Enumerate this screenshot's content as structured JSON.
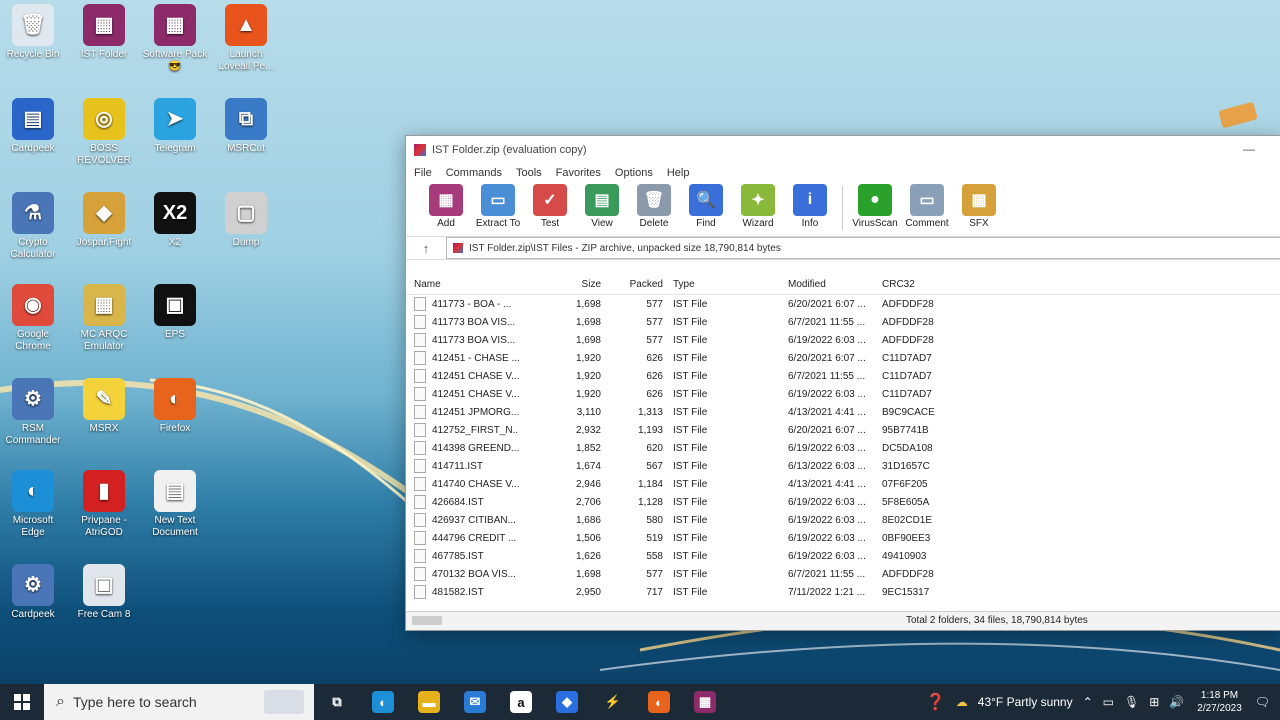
{
  "desktop": {
    "icons": [
      {
        "label": "Recycle Bin",
        "glyph": "🗑",
        "color": "#dfe8ef"
      },
      {
        "label": "IST Folder",
        "glyph": "▦",
        "color": "#8c2a6a"
      },
      {
        "label": "Software Pack 😎",
        "glyph": "▦",
        "color": "#8c2a6a"
      },
      {
        "label": "Launch Loveall Pe...",
        "glyph": "▲",
        "color": "#e8541c"
      },
      {
        "label": "Cardpeek",
        "glyph": "▤",
        "color": "#2a66c9"
      },
      {
        "label": "BOSS REVOLVER",
        "glyph": "◎",
        "color": "#e8c21c"
      },
      {
        "label": "Telegram",
        "glyph": "➤",
        "color": "#2aa3df"
      },
      {
        "label": "MSRCut",
        "glyph": "⧉",
        "color": "#3a7bc8"
      },
      {
        "label": "Crypto Calculator",
        "glyph": "⚗",
        "color": "#4a76b8"
      },
      {
        "label": "Jospar.Fight",
        "glyph": "◆",
        "color": "#d7a13a"
      },
      {
        "label": "X2",
        "glyph": "X2",
        "color": "#111111"
      },
      {
        "label": "Dump",
        "glyph": "▢",
        "color": "#d0d0d0"
      },
      {
        "label": "Google Chrome",
        "glyph": "◉",
        "color": "#e04a3a"
      },
      {
        "label": "MC ARQC Emulator",
        "glyph": "▦",
        "color": "#d9b64a"
      },
      {
        "label": "EPS",
        "glyph": "▣",
        "color": "#111111"
      },
      {
        "label": "RSM Commander",
        "glyph": "⚙",
        "color": "#4a76b8"
      },
      {
        "label": "MSRX",
        "glyph": "✎",
        "color": "#f3d23a"
      },
      {
        "label": "Firefox",
        "glyph": "◐",
        "color": "#e8641c"
      },
      {
        "label": "Microsoft Edge",
        "glyph": "◐",
        "color": "#1c8fd6"
      },
      {
        "label": "Privpane - AtriGOD",
        "glyph": "▮",
        "color": "#d32020"
      },
      {
        "label": "New Text Document",
        "glyph": "▤",
        "color": "#f0f0f0"
      },
      {
        "label": "Cardpeek",
        "glyph": "⚙",
        "color": "#4a76b8"
      },
      {
        "label": "Free Cam 8",
        "glyph": "▣",
        "color": "#e0e6ec"
      }
    ]
  },
  "window": {
    "title": "IST Folder.zip (evaluation copy)",
    "menu": [
      "File",
      "Commands",
      "Tools",
      "Favorites",
      "Options",
      "Help"
    ],
    "toolbar": [
      {
        "label": "Add",
        "color": "#a63a7a",
        "glyph": "▦"
      },
      {
        "label": "Extract To",
        "color": "#4a8fd6",
        "glyph": "▭"
      },
      {
        "label": "Test",
        "color": "#d64a4a",
        "glyph": "✓"
      },
      {
        "label": "View",
        "color": "#3a9a5a",
        "glyph": "▤"
      },
      {
        "label": "Delete",
        "color": "#8a9aaa",
        "glyph": "🗑"
      },
      {
        "label": "Find",
        "color": "#3a6fd9",
        "glyph": "🔍"
      },
      {
        "label": "Wizard",
        "color": "#8ab83a",
        "glyph": "✦"
      },
      {
        "label": "Info",
        "color": "#3a6fd9",
        "glyph": "i"
      },
      {
        "label": "VirusScan",
        "color": "#2aa12a",
        "glyph": "●"
      },
      {
        "label": "Comment",
        "color": "#8aa0b8",
        "glyph": "▭"
      },
      {
        "label": "SFX",
        "color": "#d6a03a",
        "glyph": "▦"
      }
    ],
    "address": "IST Folder.zip\\IST Files - ZIP archive, unpacked size 18,790,814 bytes",
    "up_glyph": "↑",
    "columns": {
      "name": "Name",
      "size": "Size",
      "packed": "Packed",
      "type": "Type",
      "modified": "Modified",
      "crc": "CRC32"
    },
    "rows": [
      {
        "name": "411773 - BOA - ...",
        "size": "1,698",
        "packed": "577",
        "type": "IST File",
        "modified": "6/20/2021 6:07 ...",
        "crc": "ADFDDF28"
      },
      {
        "name": "411773 BOA VIS...",
        "size": "1,698",
        "packed": "577",
        "type": "IST File",
        "modified": "6/7/2021 11:55 ...",
        "crc": "ADFDDF28"
      },
      {
        "name": "411773 BOA VIS...",
        "size": "1,698",
        "packed": "577",
        "type": "IST File",
        "modified": "6/19/2022 6:03 ...",
        "crc": "ADFDDF28"
      },
      {
        "name": "412451 - CHASE ...",
        "size": "1,920",
        "packed": "626",
        "type": "IST File",
        "modified": "6/20/2021 6:07 ...",
        "crc": "C11D7AD7"
      },
      {
        "name": "412451 CHASE V...",
        "size": "1,920",
        "packed": "626",
        "type": "IST File",
        "modified": "6/7/2021 11:55 ...",
        "crc": "C11D7AD7"
      },
      {
        "name": "412451 CHASE V...",
        "size": "1,920",
        "packed": "626",
        "type": "IST File",
        "modified": "6/19/2022 6:03 ...",
        "crc": "C11D7AD7"
      },
      {
        "name": "412451 JPMORG...",
        "size": "3,110",
        "packed": "1,313",
        "type": "IST File",
        "modified": "4/13/2021 4:41 ...",
        "crc": "B9C9CACE"
      },
      {
        "name": "412752_FIRST_N...",
        "size": "2,932",
        "packed": "1,193",
        "type": "IST File",
        "modified": "6/20/2021 6:07 ...",
        "crc": "95B7741B"
      },
      {
        "name": "414398 GREEND...",
        "size": "1,852",
        "packed": "620",
        "type": "IST File",
        "modified": "6/19/2022 6:03 ...",
        "crc": "DC5DA108"
      },
      {
        "name": "414711.IST",
        "size": "1,674",
        "packed": "567",
        "type": "IST File",
        "modified": "6/13/2022 6:03 ...",
        "crc": "31D1657C"
      },
      {
        "name": "414740 CHASE V...",
        "size": "2,946",
        "packed": "1,184",
        "type": "IST File",
        "modified": "4/13/2021 4:41 ...",
        "crc": "07F6F205"
      },
      {
        "name": "426684.IST",
        "size": "2,706",
        "packed": "1,128",
        "type": "IST File",
        "modified": "6/19/2022 6:03 ...",
        "crc": "5F8E605A"
      },
      {
        "name": "426937 CITIBAN...",
        "size": "1,686",
        "packed": "580",
        "type": "IST File",
        "modified": "6/19/2022 6:03 ...",
        "crc": "8E02CD1E"
      },
      {
        "name": "444796 CREDIT ...",
        "size": "1,506",
        "packed": "519",
        "type": "IST File",
        "modified": "6/19/2022 6:03 ...",
        "crc": "0BF90EE3"
      },
      {
        "name": "467785.IST",
        "size": "1,626",
        "packed": "558",
        "type": "IST File",
        "modified": "6/19/2022 6:03 ...",
        "crc": "49410903"
      },
      {
        "name": "470132 BOA VIS...",
        "size": "1,698",
        "packed": "577",
        "type": "IST File",
        "modified": "6/7/2021 11:55 ...",
        "crc": "ADFDDF28"
      },
      {
        "name": "481582.IST",
        "size": "2,950",
        "packed": "717",
        "type": "IST File",
        "modified": "7/11/2022 1:21 ...",
        "crc": "9EC15317"
      }
    ],
    "status": "Total 2 folders, 34 files, 18,790,814 bytes"
  },
  "taskbar": {
    "search_placeholder": "Type here to search",
    "apps": [
      {
        "name": "task-view",
        "glyph": "⧉",
        "color": "#1c2a38"
      },
      {
        "name": "edge",
        "glyph": "◐",
        "color": "#1c8fd6"
      },
      {
        "name": "file-explorer",
        "glyph": "▬",
        "color": "#e6b21c"
      },
      {
        "name": "mail",
        "glyph": "✉",
        "color": "#2a7bd6"
      },
      {
        "name": "amazon",
        "glyph": "a",
        "color": "#ffffff"
      },
      {
        "name": "dropbox",
        "glyph": "◆",
        "color": "#2a6fe0"
      },
      {
        "name": "winamp-like",
        "glyph": "⚡",
        "color": "#1c2a38"
      },
      {
        "name": "firefox",
        "glyph": "◐",
        "color": "#e8641c"
      },
      {
        "name": "winrar",
        "glyph": "▦",
        "color": "#8c2a6a"
      }
    ],
    "weather": "43°F  Partly sunny",
    "time": "1:18 PM",
    "date": "2/27/2023"
  }
}
